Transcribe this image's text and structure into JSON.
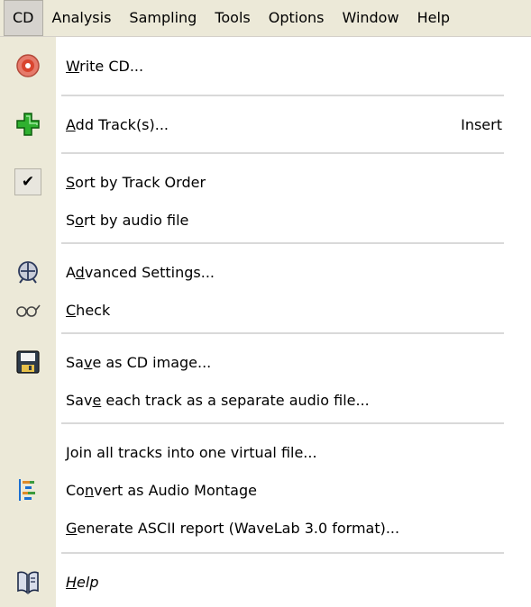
{
  "menubar": {
    "items": [
      "CD",
      "Analysis",
      "Sampling",
      "Tools",
      "Options",
      "Window",
      "Help"
    ]
  },
  "menu": {
    "items": [
      {
        "name": "write-cd",
        "pre": "",
        "ul": "W",
        "post": "rite CD...",
        "icon": "cd-icon"
      },
      {
        "name": "add-tracks",
        "pre": "",
        "ul": "A",
        "post": "dd Track(s)...",
        "shortcut": "Insert",
        "icon": "add-track-icon"
      },
      {
        "name": "sort-by-track-order",
        "pre": "",
        "ul": "S",
        "post": "ort by Track Order",
        "checked": true
      },
      {
        "name": "sort-by-audio-file",
        "pre": "S",
        "ul": "o",
        "post": "rt by audio file"
      },
      {
        "name": "advanced-settings",
        "pre": "A",
        "ul": "d",
        "post": "vanced Settings...",
        "icon": "advanced-settings-icon"
      },
      {
        "name": "check",
        "pre": "",
        "ul": "C",
        "post": "heck",
        "icon": "glasses-icon"
      },
      {
        "name": "save-as-cd-image",
        "pre": "Sa",
        "ul": "v",
        "post": "e as CD image...",
        "icon": "floppy-icon"
      },
      {
        "name": "save-each-track",
        "pre": "Sav",
        "ul": "e",
        "post": " each track as a separate audio file..."
      },
      {
        "name": "join-all-tracks",
        "pre": "",
        "ul": "J",
        "post": "oin all tracks into one virtual file..."
      },
      {
        "name": "convert-audio-montage",
        "pre": "Co",
        "ul": "n",
        "post": "vert as Audio Montage",
        "icon": "montage-icon"
      },
      {
        "name": "generate-ascii-report",
        "pre": "",
        "ul": "G",
        "post": "enerate ASCII report (WaveLab 3.0 format)..."
      },
      {
        "name": "help",
        "pre": "",
        "ul": "H",
        "post": "elp",
        "icon": "help-book-icon"
      }
    ]
  },
  "colors": {
    "menubar_bg": "#ece9d8",
    "icon_column_bg": "#ece9d8",
    "separator": "#d9d9d9"
  }
}
